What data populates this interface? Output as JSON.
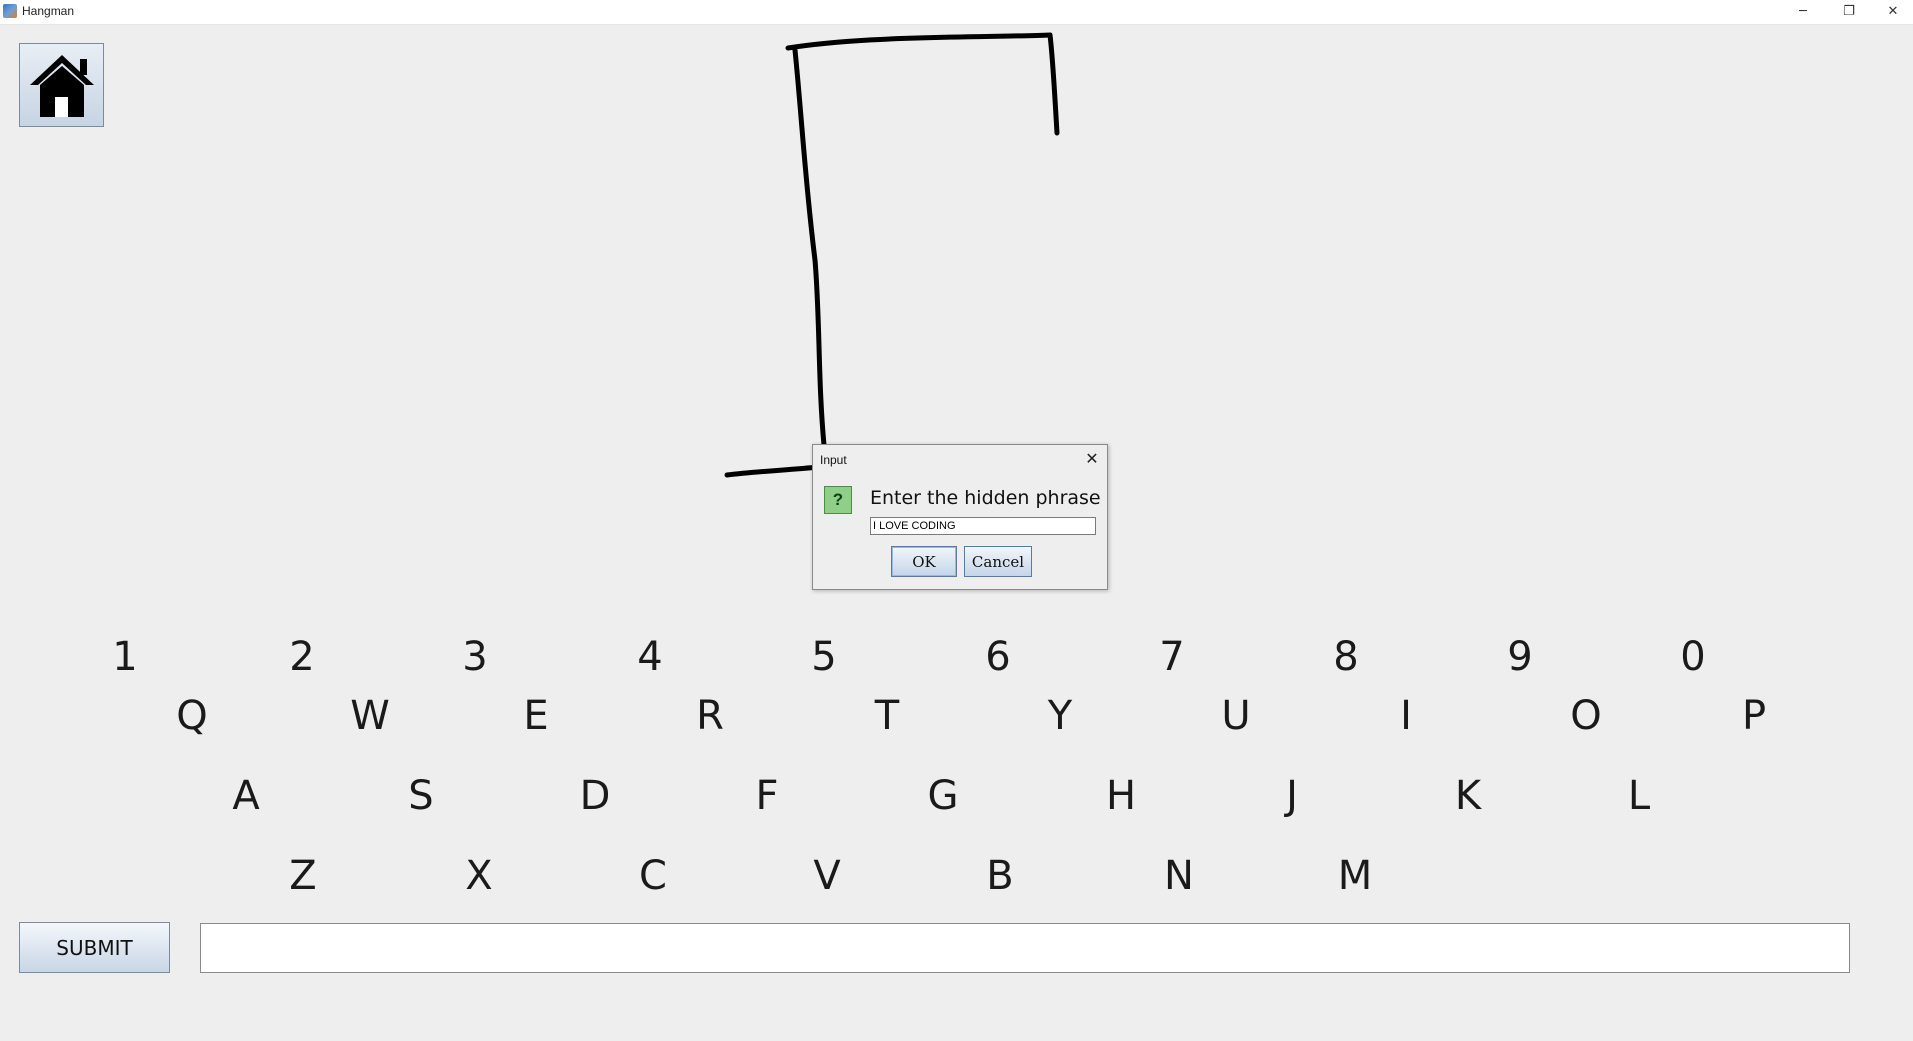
{
  "window": {
    "title": "Hangman",
    "minimize_glyph": "─",
    "maximize_glyph": "❐",
    "close_glyph": "✕"
  },
  "home": {
    "icon": "home-icon"
  },
  "dialog": {
    "title": "Input",
    "close_glyph": "✕",
    "icon_glyph": "?",
    "message": "Enter the hidden phrase",
    "input_value": "I LOVE CODING",
    "ok_label": "OK",
    "cancel_label": "Cancel"
  },
  "keyboard": {
    "numbers": [
      "1",
      "2",
      "3",
      "4",
      "5",
      "6",
      "7",
      "8",
      "9",
      "0"
    ],
    "row1": [
      "Q",
      "W",
      "E",
      "R",
      "T",
      "Y",
      "U",
      "I",
      "O",
      "P"
    ],
    "row2": [
      "A",
      "S",
      "D",
      "F",
      "G",
      "H",
      "J",
      "K",
      "L"
    ],
    "row3": [
      "Z",
      "X",
      "C",
      "V",
      "B",
      "N",
      "M"
    ]
  },
  "bottom": {
    "submit_label": "SUBMIT",
    "guess_value": ""
  }
}
